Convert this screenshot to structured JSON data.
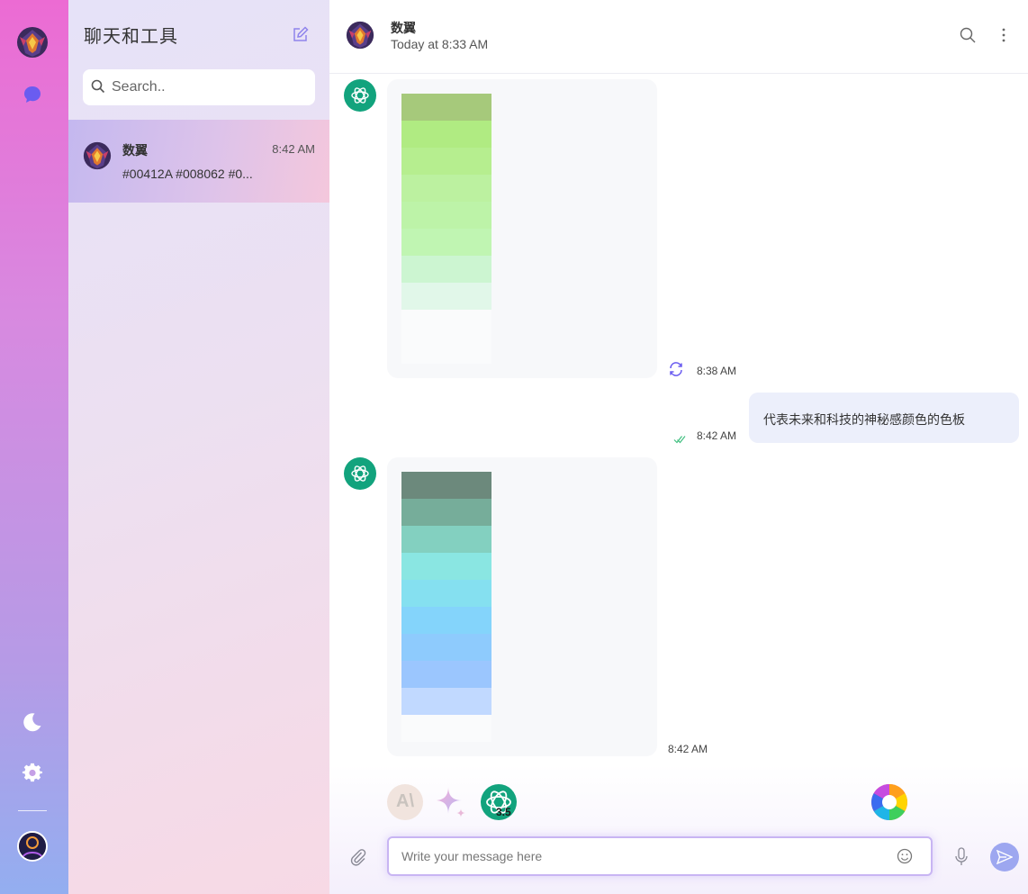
{
  "sidebar": {
    "nav_items": [
      {
        "icon": "app-logo-icon"
      },
      {
        "icon": "chat-bubble-icon",
        "color": "#6a5cf0"
      }
    ],
    "bottom_items": [
      {
        "icon": "moon-icon"
      },
      {
        "icon": "gear-icon"
      },
      {
        "icon": "user-avatar-icon"
      }
    ]
  },
  "chat_list": {
    "title": "聊天和工具",
    "search_placeholder": "Search..",
    "conversations": [
      {
        "name": "数翼",
        "time": "8:42 AM",
        "preview": "#00412A #008062 #0..."
      }
    ]
  },
  "chat_header": {
    "name": "数翼",
    "status": "Today at 8:33 AM"
  },
  "messages": [
    {
      "sender": "assistant",
      "type": "palette",
      "colors": [
        "#a6c97b",
        "#b0eb82",
        "#b6ee8f",
        "#bcf1a0",
        "#bdf3a8",
        "#c0f5b2",
        "#ccf5d1",
        "#e1f7e9",
        "#fafbfc",
        "#fafbfc"
      ],
      "time": "8:38 AM"
    },
    {
      "sender": "user",
      "text": "代表未来和科技的神秘感颜色的色板",
      "time": "8:42 AM"
    },
    {
      "sender": "assistant",
      "type": "palette",
      "colors": [
        "#6c897c",
        "#76ad9a",
        "#83d0c0",
        "#8ae6e2",
        "#85e0f0",
        "#84d4fb",
        "#8ecbfd",
        "#9bc6fe",
        "#c1d9ff",
        "#fafbfc"
      ],
      "time": "8:42 AM"
    }
  ],
  "composer": {
    "placeholder": "Write your message here",
    "models": [
      {
        "name": "anthropic",
        "label": "A\\"
      },
      {
        "name": "gemini"
      },
      {
        "name": "chatgpt",
        "version": "3.5"
      },
      {
        "name": "color-wheel"
      }
    ],
    "accent_color": "#9da7f0"
  }
}
